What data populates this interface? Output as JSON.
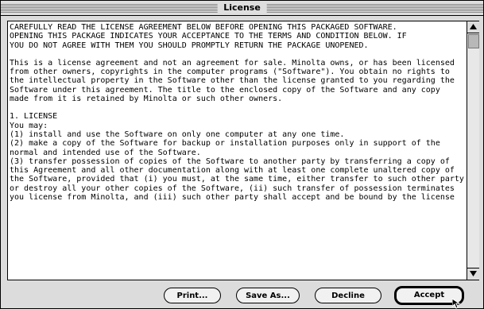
{
  "window": {
    "title": "License"
  },
  "license_text": {
    "p1": "CAREFULLY READ THE LICENSE AGREEMENT BELOW BEFORE OPENING THIS PACKAGED SOFTWARE.\nOPENING THIS PACKAGE INDICATES YOUR ACCEPTANCE TO THE TERMS AND CONDITION BELOW. IF\nYOU DO NOT AGREE WITH THEM YOU SHOULD PROMPTLY RETURN THE PACKAGE UNOPENED.",
    "p2": "This is a license agreement and not an agreement for sale. Minolta owns, or has been licensed\nfrom other owners, copyrights in the computer programs (\"Software\"). You obtain no rights to\nthe intellectual property in the Software other than the license granted to you regarding the\nSoftware under this agreement. The title to the enclosed copy of the Software and any copy\nmade from it is retained by Minolta or such other owners.",
    "p3": "1. LICENSE\nYou may:\n(1) install and use the Software on only one computer at any one time.\n(2) make a copy of the Software for backup or installation purposes only in support of the\nnormal and intended use of the Software.\n(3) transfer possession of copies of the Software to another party by transferring a copy of\nthis Agreement and all other documentation along with at least one complete unaltered copy of\nthe Software, provided that (i) you must, at the same time, either transfer to such other party\nor destroy all your other copies of the Software, (ii) such transfer of possession terminates\nyou license from Minolta, and (iii) such other party shall accept and be bound by the license"
  },
  "buttons": {
    "print": "Print...",
    "save_as": "Save As...",
    "decline": "Decline",
    "accept": "Accept"
  }
}
